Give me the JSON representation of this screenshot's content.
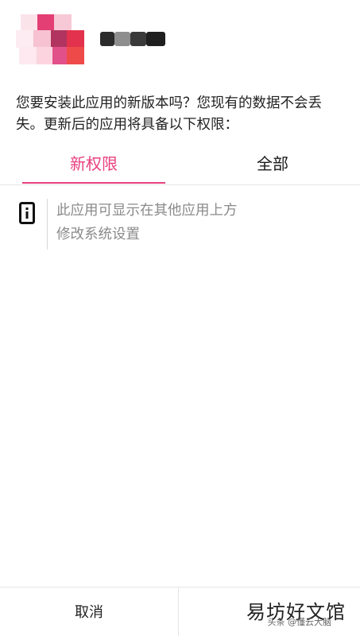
{
  "dialog": {
    "prompt": "您要安装此应用的新版本吗？您现有的数据不会丢失。更新后的应用将具备以下权限：",
    "tabs": [
      {
        "label": "新权限",
        "selected": true
      },
      {
        "label": "全部",
        "selected": false
      }
    ],
    "permissions": [
      "此应用可显示在其他应用上方",
      "修改系统设置"
    ],
    "buttons": {
      "cancel": "取消"
    }
  },
  "watermark": {
    "main": "易坊好文馆",
    "sub": "头条 @懂云大脑"
  },
  "colors": {
    "accent": "#e8407e",
    "text": "#222222",
    "muted": "#8a8a8a"
  }
}
